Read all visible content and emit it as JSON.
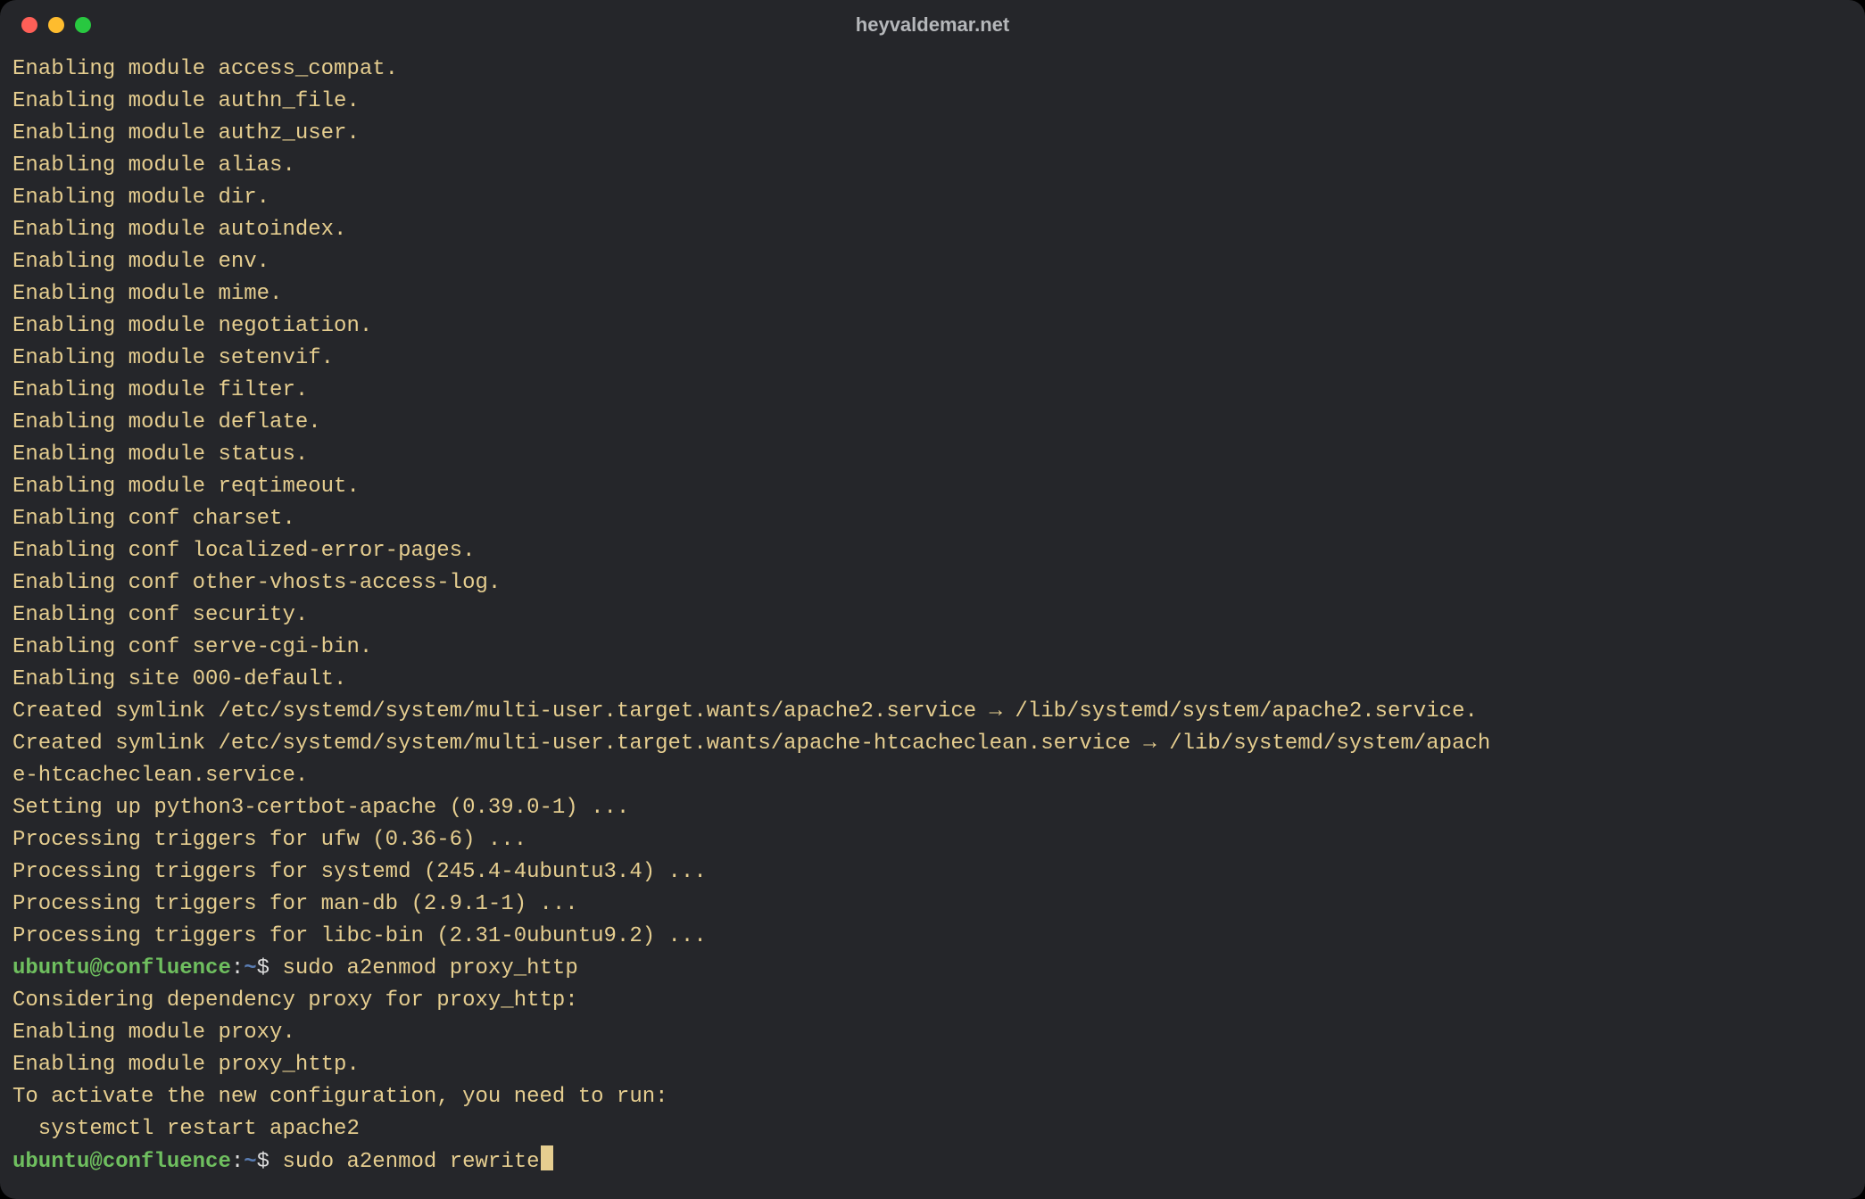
{
  "window": {
    "title": "heyvaldemar.net",
    "traffic_lights": [
      "close",
      "minimize",
      "zoom"
    ]
  },
  "prompt": {
    "user": "ubuntu",
    "host": "confluence",
    "path": "~",
    "symbol": "$"
  },
  "output_lines": [
    "Enabling module access_compat.",
    "Enabling module authn_file.",
    "Enabling module authz_user.",
    "Enabling module alias.",
    "Enabling module dir.",
    "Enabling module autoindex.",
    "Enabling module env.",
    "Enabling module mime.",
    "Enabling module negotiation.",
    "Enabling module setenvif.",
    "Enabling module filter.",
    "Enabling module deflate.",
    "Enabling module status.",
    "Enabling module reqtimeout.",
    "Enabling conf charset.",
    "Enabling conf localized-error-pages.",
    "Enabling conf other-vhosts-access-log.",
    "Enabling conf security.",
    "Enabling conf serve-cgi-bin.",
    "Enabling site 000-default.",
    "Created symlink /etc/systemd/system/multi-user.target.wants/apache2.service → /lib/systemd/system/apache2.service.",
    "Created symlink /etc/systemd/system/multi-user.target.wants/apache-htcacheclean.service → /lib/systemd/system/apach",
    "e-htcacheclean.service.",
    "Setting up python3-certbot-apache (0.39.0-1) ...",
    "Processing triggers for ufw (0.36-6) ...",
    "Processing triggers for systemd (245.4-4ubuntu3.4) ...",
    "Processing triggers for man-db (2.9.1-1) ...",
    "Processing triggers for libc-bin (2.31-0ubuntu9.2) ..."
  ],
  "commands": {
    "first": "sudo a2enmod proxy_http",
    "first_output": [
      "Considering dependency proxy for proxy_http:",
      "Enabling module proxy.",
      "Enabling module proxy_http.",
      "To activate the new configuration, you need to run:",
      "  systemctl restart apache2"
    ],
    "current": "sudo a2enmod rewrite"
  }
}
